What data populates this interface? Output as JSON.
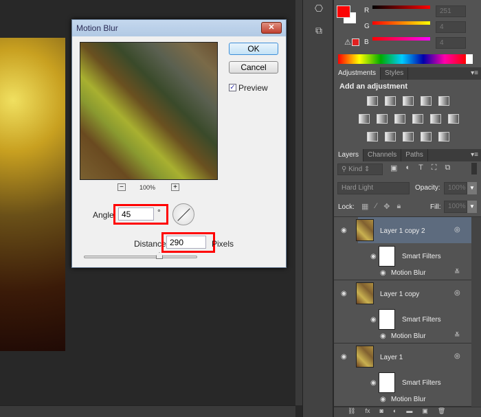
{
  "dialog": {
    "title": "Motion Blur",
    "ok": "OK",
    "cancel": "Cancel",
    "preview_label": "Preview",
    "preview_checked": true,
    "zoom": "100%",
    "zoom_out": "−",
    "zoom_in": "+",
    "angle_label": "Angle",
    "angle_value": "45",
    "angle_unit": "°",
    "distance_label": "Distance:",
    "distance_value": "290",
    "distance_unit": "Pixels",
    "distance_slider": 0.55,
    "close": "✕"
  },
  "color": {
    "r_label": "R",
    "g_label": "G",
    "b_label": "B",
    "r": "251",
    "g": "4",
    "b": "4",
    "fg": "#fb0404",
    "bg": "#ffffff"
  },
  "adjustments": {
    "tabs": [
      "Adjustments",
      "Styles"
    ],
    "heading": "Add an adjustment"
  },
  "layers": {
    "tabs": [
      "Layers",
      "Channels",
      "Paths"
    ],
    "filter": "Kind",
    "blend_mode": "Hard Light",
    "opacity_label": "Opacity:",
    "opacity": "100%",
    "lock_label": "Lock:",
    "fill_label": "Fill:",
    "fill": "100%",
    "items": [
      {
        "name": "Layer 1 copy 2",
        "selected": true,
        "smart_filters": "Smart Filters",
        "filter": "Motion Blur"
      },
      {
        "name": "Layer 1 copy",
        "selected": false,
        "smart_filters": "Smart Filters",
        "filter": "Motion Blur"
      },
      {
        "name": "Layer 1",
        "selected": false,
        "smart_filters": "Smart Filters",
        "filter": "Motion Blur"
      }
    ],
    "footer_icons": [
      "link",
      "fx",
      "mask",
      "adjustment",
      "group",
      "new-layer",
      "trash"
    ]
  }
}
